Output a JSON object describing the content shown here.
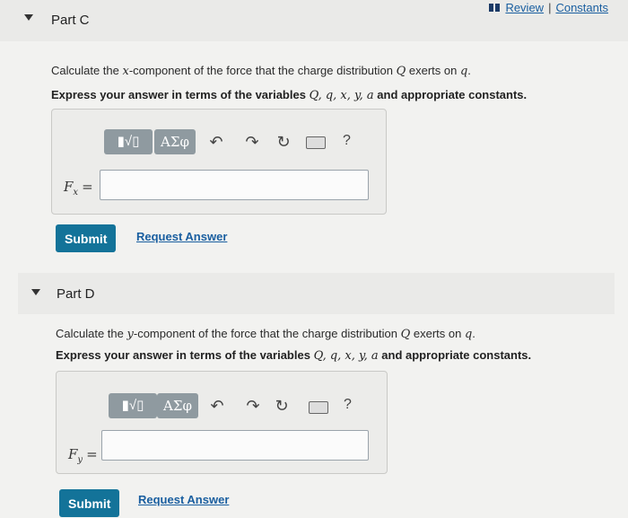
{
  "header": {
    "review_label": "Review",
    "separator": "|",
    "constants_label": "Constants"
  },
  "part_c": {
    "title": "Part C",
    "question": {
      "pre": "Calculate the ",
      "component": "x",
      "mid": "-component of the force that the charge distribution ",
      "charge": "Q",
      "post": " exerts on ",
      "target": "q",
      "end": "."
    },
    "instruction": {
      "pre": "Express your answer in terms of the variables ",
      "vars": "Q, q, x, y, a",
      "post": " and appropriate constants."
    },
    "toolbar": {
      "templates_label": "▮√▯",
      "symbols_label": "ΑΣφ",
      "undo_icon": "↶",
      "redo_icon": "↷",
      "reset_icon": "↻",
      "help_label": "?"
    },
    "variable": "F",
    "subscript": "x",
    "equals": "=",
    "input_value": "",
    "submit_label": "Submit",
    "request_label": "Request Answer"
  },
  "part_d": {
    "title": "Part D",
    "question": {
      "pre": "Calculate the ",
      "component": "y",
      "mid": "-component of the force that the charge distribution ",
      "charge": "Q",
      "post": " exerts on ",
      "target": "q",
      "end": "."
    },
    "instruction": {
      "pre": "Express your answer in terms of the variables ",
      "vars": "Q, q, x, y, a",
      "post": " and appropriate constants."
    },
    "toolbar": {
      "templates_label": "▮√▯",
      "symbols_label": "ΑΣφ",
      "undo_icon": "↶",
      "redo_icon": "↷",
      "reset_icon": "↻",
      "help_label": "?"
    },
    "variable": "F",
    "subscript": "y",
    "equals": "=",
    "input_value": "",
    "submit_label": "Submit",
    "request_label": "Request Answer"
  },
  "colors": {
    "accent": "#137399",
    "link": "#1a5fa0",
    "tool_button": "#8f9aa0"
  }
}
